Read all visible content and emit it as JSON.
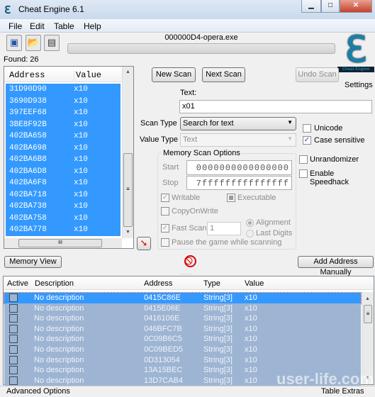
{
  "window": {
    "title": "Cheat Engine 6.1",
    "controls": [
      "minimize",
      "maximize",
      "close"
    ]
  },
  "menu": [
    "File",
    "Edit",
    "Table",
    "Help"
  ],
  "toolbar": {
    "icons": [
      "select-process-icon",
      "open-icon",
      "save-icon"
    ]
  },
  "process_name": "000000D4-opera.exe",
  "progress": 0,
  "logo_text": "Cheat Engine",
  "settings_label": "Settings",
  "found": "Found: 26",
  "results": {
    "headers": [
      "Address",
      "Value"
    ],
    "rows": [
      [
        "31D90D90",
        "x10"
      ],
      [
        "3690D938",
        "x10"
      ],
      [
        "397EEF68",
        "x10"
      ],
      [
        "3BE8F92B",
        "x10"
      ],
      [
        "402BA658",
        "x10"
      ],
      [
        "402BA698",
        "x10"
      ],
      [
        "402BA6B8",
        "x10"
      ],
      [
        "402BA6D8",
        "x10"
      ],
      [
        "402BA6F8",
        "x10"
      ],
      [
        "402BA718",
        "x10"
      ],
      [
        "402BA738",
        "x10"
      ],
      [
        "402BA758",
        "x10"
      ],
      [
        "402BA778",
        "x10"
      ]
    ]
  },
  "scan": {
    "new_scan": "New Scan",
    "next_scan": "Next Scan",
    "undo_scan": "Undo Scan",
    "text_label": "Text:",
    "text_value": "x01",
    "scan_type_label": "Scan Type",
    "scan_type_value": "Search for text",
    "value_type_label": "Value Type",
    "value_type_value": "Text",
    "unicode": "Unicode",
    "unicode_checked": false,
    "case_sensitive": "Case sensitive",
    "case_sensitive_checked": true,
    "unrandomizer": "Unrandomizer",
    "speedhack": "Enable Speedhack"
  },
  "memory_options": {
    "title": "Memory Scan Options",
    "start_label": "Start",
    "start_value": "0000000000000000",
    "stop_label": "Stop",
    "stop_value": "7fffffffffffffff",
    "writable": "Writable",
    "executable": "Executable",
    "copyonwrite": "CopyOnWrite",
    "fast_scan": "Fast Scan",
    "fast_scan_value": "1",
    "alignment": "Alignment",
    "last_digits": "Last Digits",
    "pause": "Pause the game while scanning"
  },
  "memory_view": "Memory View",
  "add_address": "Add Address Manually",
  "cheat_table": {
    "headers": [
      "Active",
      "Description",
      "Address",
      "Type",
      "Value"
    ],
    "rows": [
      [
        "No description",
        "0415C86E",
        "String[3]",
        "x10"
      ],
      [
        "No description",
        "0415E06E",
        "String[3]",
        "x10"
      ],
      [
        "No description",
        "0416106E",
        "String[3]",
        "x10"
      ],
      [
        "No description",
        "046BFC7B",
        "String[3]",
        "x10"
      ],
      [
        "No description",
        "0C09B6C5",
        "String[3]",
        "x10"
      ],
      [
        "No description",
        "0C09BED5",
        "String[3]",
        "x10"
      ],
      [
        "No description",
        "0D313054",
        "String[3]",
        "x10"
      ],
      [
        "No description",
        "13A15BEC",
        "String[3]",
        "x10"
      ],
      [
        "No description",
        "13D7CAB4",
        "String[3]",
        "x10"
      ]
    ]
  },
  "footer": {
    "advanced": "Advanced Options",
    "extras": "Table Extras"
  },
  "watermark": "user-life.com",
  "colors": {
    "selection": "#3399ff",
    "table_row": "#9db5d2"
  }
}
